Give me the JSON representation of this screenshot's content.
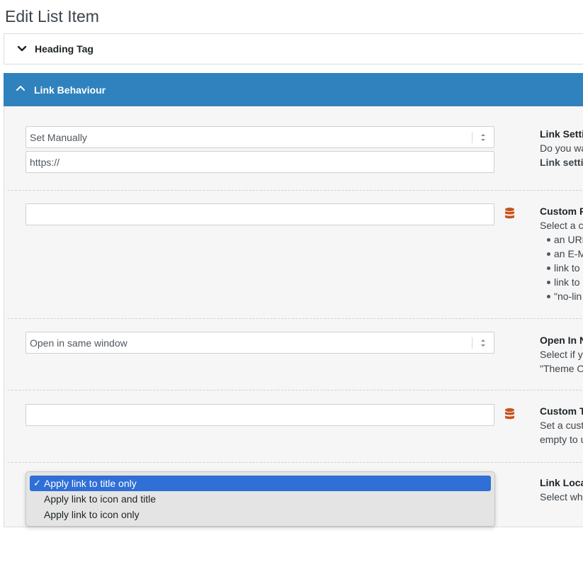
{
  "page": {
    "title": "Edit List Item"
  },
  "panels": {
    "heading_tag": {
      "label": "Heading Tag"
    },
    "link_behaviour": {
      "label": "Link Behaviour",
      "accent_color": "#2f82bd"
    }
  },
  "link_settings": {
    "select_value": "Set Manually",
    "url_value": "https://",
    "desc_title": "Link Setti",
    "desc_line1": "Do you wa",
    "desc_line2": "Link settin"
  },
  "custom_field": {
    "value": "",
    "icon": "database-icon",
    "desc_title": "Custom F",
    "desc_line1": "Select a c",
    "bullets": [
      "an URL",
      "an E-M",
      "link to",
      "link to",
      "\"no-lin"
    ]
  },
  "open_in": {
    "select_value": "Open in same window",
    "desc_title": "Open In N",
    "desc_line1": "Select if y",
    "desc_line2": "\"Theme O"
  },
  "custom_title": {
    "value": "",
    "icon": "database-icon",
    "desc_title": "Custom T",
    "desc_line1": "Set a cust",
    "desc_line2": "empty to u"
  },
  "link_location": {
    "desc_title": "Link Loca",
    "desc_line1": "Select whe",
    "options": [
      {
        "label": "Apply link to title only",
        "selected": true
      },
      {
        "label": "Apply link to icon and title",
        "selected": false
      },
      {
        "label": "Apply link to icon only",
        "selected": false
      }
    ],
    "check_mark": "✓"
  },
  "colors": {
    "icon": "#c8541e",
    "selected_option": "#2f6fd6"
  }
}
